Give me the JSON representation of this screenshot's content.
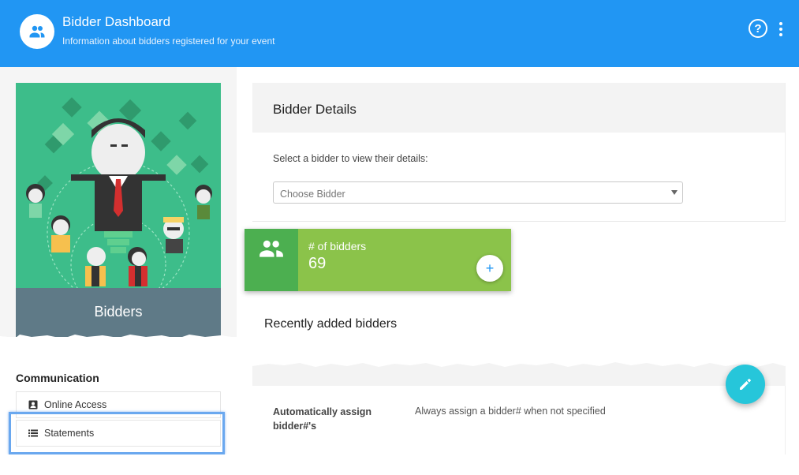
{
  "header": {
    "title": "Bidder Dashboard",
    "subtitle": "Information about bidders registered for your event",
    "avatar_icon": "group-icon",
    "help_icon": "help-circle-icon",
    "help_glyph": "?",
    "more_icon": "more-vert-icon",
    "background": "#2196f3"
  },
  "hero": {
    "caption": "Bidders",
    "illustration": "people-network-illustration"
  },
  "bidder_details": {
    "title": "Bidder Details",
    "prompt": "Select a bidder to view their details:",
    "select_placeholder": "Choose Bidder"
  },
  "stat": {
    "label": "# of bidders",
    "value": "69",
    "icon": "group-icon",
    "add_glyph": "+"
  },
  "recent": {
    "title": "Recently added bidders"
  },
  "communication": {
    "title": "Communication",
    "items": [
      {
        "label": "Online Access",
        "icon": "account-box-icon"
      },
      {
        "label": "Statements",
        "icon": "list-icon"
      }
    ]
  },
  "settings": {
    "rows": [
      {
        "label": "Automatically assign bidder#'s",
        "value": "Always assign a bidder# when not specified"
      }
    ]
  },
  "fab": {
    "icon": "pencil-icon"
  },
  "colors": {
    "primary": "#2196f3",
    "hero_green": "#3dbd8a",
    "caption_slate": "#5f7a87",
    "stat_green": "#8bc34a",
    "stat_green_dark": "#4caf50",
    "fab_teal": "#26c6da"
  }
}
